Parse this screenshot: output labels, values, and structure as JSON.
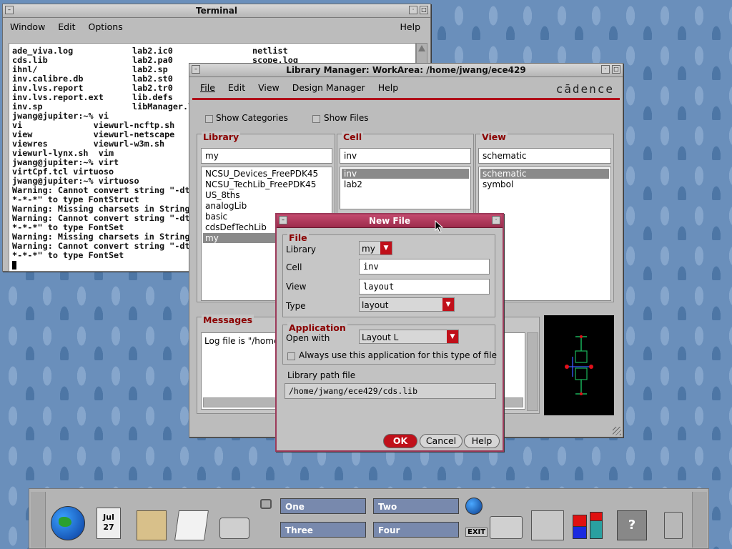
{
  "terminal": {
    "title": "Terminal",
    "menu": [
      "Window",
      "Edit",
      "Options"
    ],
    "help": "Help",
    "columns": [
      {
        "lines": [
          "ade_viva.log",
          "cds.lib",
          "ihnl/",
          "inv.calibre.db",
          "inv.lvs.report",
          "inv.lvs.report.ext",
          "inv.sp"
        ]
      },
      {
        "lines": [
          "lab2.ic0",
          "lab2.pa0",
          "lab2.sp",
          "lab2.st0",
          "lab2.tr0",
          "lib.defs",
          "libManager.l"
        ]
      },
      {
        "lines": [
          "netlist",
          "scope.log"
        ]
      }
    ],
    "rest": [
      "jwang@jupiter:~% vi",
      "vi              viewurl-ncftp.sh",
      "view            viewurl-netscape",
      "viewres         viewurl-w3m.sh",
      "viewurl-lynx.sh  vim",
      "jwang@jupiter:~% virt",
      "virtCpf.tcl virtuoso",
      "jwang@jupiter:~% virtuoso",
      "Warning: Cannot convert string \"-dt-",
      "*-*-*\" to type FontStruct",
      "Warning: Missing charsets in String",
      "Warning: Cannot convert string \"-dt-",
      "*-*-*\" to type FontSet",
      "Warning: Missing charsets in String",
      "Warning: Cannot convert string \"-dt-",
      "*-*-*\" to type FontSet"
    ]
  },
  "libmgr": {
    "title": "Library Manager: WorkArea: /home/jwang/ece429",
    "menu": [
      "File",
      "Edit",
      "View",
      "Design Manager",
      "Help"
    ],
    "brand": "cādence",
    "show_categories": "Show Categories",
    "show_files": "Show Files",
    "library": {
      "label": "Library",
      "filter": "my",
      "items": [
        "NCSU_Devices_FreePDK45",
        "NCSU_TechLib_FreePDK45",
        "US_8ths",
        "analogLib",
        "basic",
        "cdsDefTechLib",
        "my"
      ],
      "selected": 6
    },
    "cell": {
      "label": "Cell",
      "filter": "inv",
      "items": [
        "inv",
        "lab2"
      ],
      "selected": 0
    },
    "view": {
      "label": "View",
      "filter": "schematic",
      "items": [
        "schematic",
        "symbol"
      ],
      "selected": 0
    },
    "messages": {
      "label": "Messages",
      "text": "Log file is \"/home/"
    }
  },
  "newfile": {
    "title": "New File",
    "file_group": "File",
    "library_label": "Library",
    "library_value": "my",
    "cell_label": "Cell",
    "cell_value": "inv",
    "view_label": "View",
    "view_value": "layout",
    "type_label": "Type",
    "type_value": "layout",
    "app_group": "Application",
    "openwith_label": "Open with",
    "openwith_value": "Layout L",
    "always_label": "Always use this application for this type of file",
    "libpath_label": "Library path file",
    "libpath_value": "/home/jwang/ece429/cds.lib",
    "ok": "OK",
    "cancel": "Cancel",
    "help": "Help"
  },
  "panel": {
    "date_month": "Jul",
    "date_day": "27",
    "workspaces": [
      "One",
      "Two",
      "Three",
      "Four"
    ],
    "exit": "EXIT"
  }
}
